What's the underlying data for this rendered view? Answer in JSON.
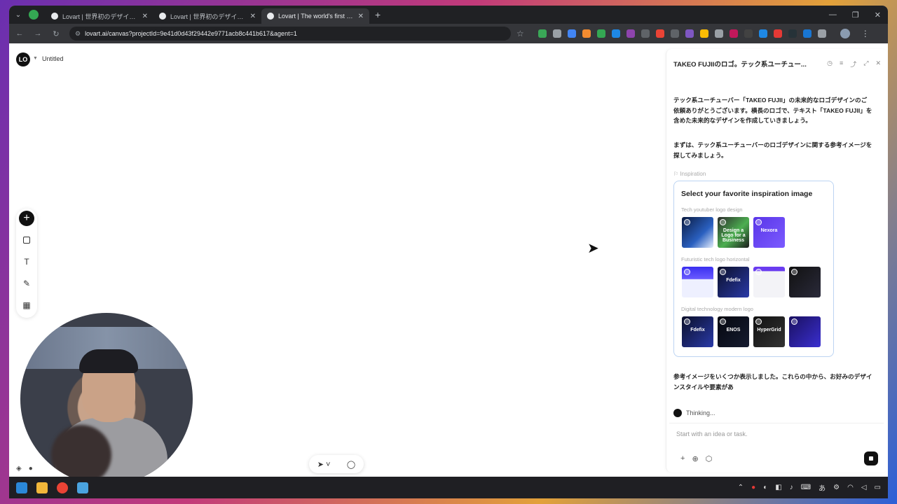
{
  "browser": {
    "tabs": [
      {
        "title": "Lovart | 世界初のデザインエージェ...",
        "active": false
      },
      {
        "title": "Lovart | 世界初のデザインエージェ...",
        "active": false
      },
      {
        "title": "Lovart | The world's first design...",
        "active": true
      }
    ],
    "new_tab": "+",
    "url": "lovart.ai/canvas?projectId=9e41d0d43f29442e9771acb8c441b617&agent=1"
  },
  "canvas": {
    "project_title": "Untitled",
    "logo_text": "LO"
  },
  "chat": {
    "title": "TAKEO FUJIIのロゴ。テック系ユーチュー...",
    "message_1": "テック系ユーチューバー「TAKEO FUJII」の未来的なロゴデザインのご依頼ありがとうございます。横長のロゴで、テキスト「TAKEO FUJII」を含めた未来的なデザインを作成していきましょう。",
    "message_2": "まずは、テック系ユーチューバーのロゴデザインに関する参考イメージを探してみましょう。",
    "inspiration_label": "Inspiration",
    "card_title": "Select your favorite inspiration image",
    "groups": [
      {
        "label": "Tech youtuber logo design",
        "thumbs": [
          {
            "text": "",
            "bg": "linear-gradient(135deg,#0a1a40,#2a60c0 60%,#e6eefc)"
          },
          {
            "text": "Design a Logo for a Business",
            "bg": "linear-gradient(135deg,#2c2c2c,#4caf50 55%,#1c1c1c)"
          },
          {
            "text": "Nexora",
            "bg": "linear-gradient(135deg,#5a36e8,#7b5bff)"
          },
          {
            "text": "",
            "bg": "#ffffff"
          }
        ]
      },
      {
        "label": "Futuristic tech logo horizontal",
        "thumbs": [
          {
            "text": "",
            "bg": "linear-gradient(180deg,#3a2ff0 0%,#6a5bff 40%,#eef0ff 41%)"
          },
          {
            "text": "Fdefix",
            "bg": "linear-gradient(135deg,#0b0f2a,#2a3aa8)"
          },
          {
            "text": "",
            "bg": "linear-gradient(180deg,#6a3cf0 0 14%,#f3f3f7 15%)"
          },
          {
            "text": "",
            "bg": "linear-gradient(135deg,#111,#2a2a3a)"
          }
        ]
      },
      {
        "label": "Digital technology modern logo",
        "thumbs": [
          {
            "text": "Fdefix",
            "bg": "linear-gradient(135deg,#0b0f2a,#2a3aa8)"
          },
          {
            "text": "ENOS",
            "bg": "linear-gradient(135deg,#05070f,#161c30)"
          },
          {
            "text": "HyperGrid",
            "bg": "linear-gradient(135deg,#111,#333)"
          },
          {
            "text": "",
            "bg": "linear-gradient(135deg,#1a1060,#3a2fd0)"
          }
        ]
      }
    ],
    "message_3": "参考イメージをいくつか表示しました。これらの中から、お好みのデザインスタイルや要素があ",
    "status": "Thinking...",
    "input_placeholder": "Start with an idea or task."
  }
}
